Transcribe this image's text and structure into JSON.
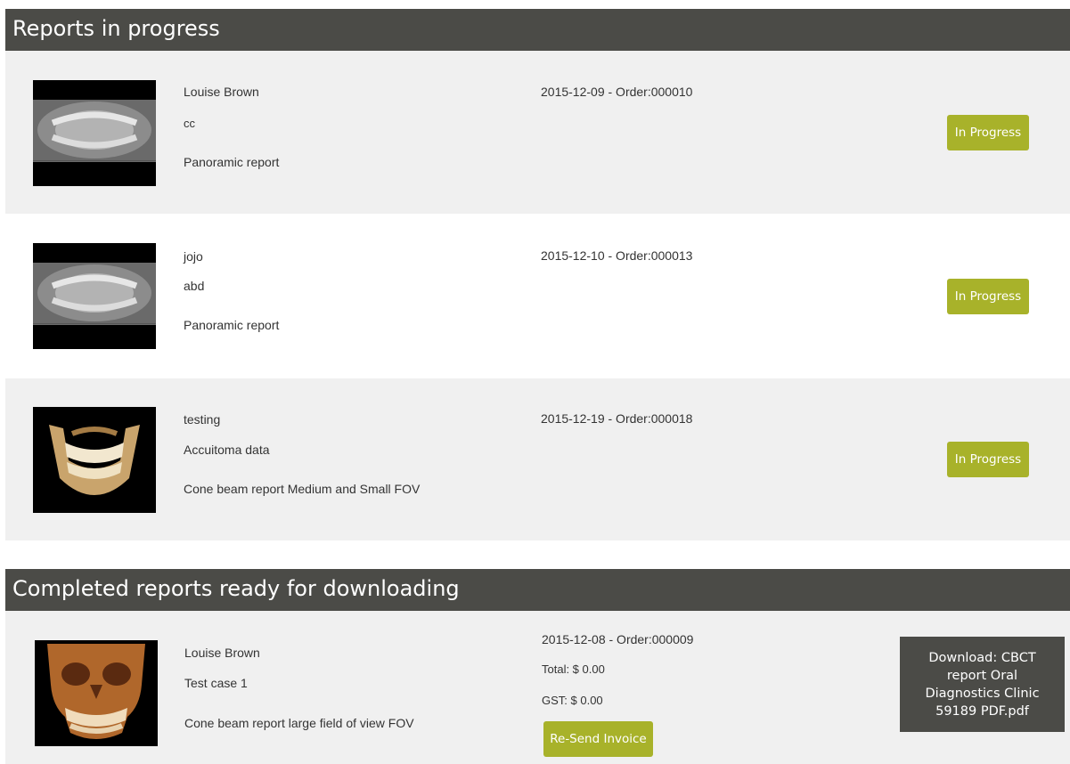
{
  "in_progress": {
    "title": "Reports in progress",
    "items": [
      {
        "patient": "Louise Brown",
        "note": "cc",
        "report_type": "Panoramic report",
        "order": "2015-12-09 - Order:000010",
        "status": "In Progress",
        "image": "panoramic-xray"
      },
      {
        "patient": "jojo",
        "note": "abd",
        "report_type": "Panoramic report",
        "order": "2015-12-10 - Order:000013",
        "status": "In Progress",
        "image": "panoramic-xray"
      },
      {
        "patient": "testing",
        "note": "Accuitoma data",
        "report_type": "Cone beam report Medium and Small FOV",
        "order": "2015-12-19 - Order:000018",
        "status": "In Progress",
        "image": "cbct-jaw-render"
      }
    ]
  },
  "completed": {
    "title": "Completed reports ready for downloading",
    "items": [
      {
        "patient": "Louise Brown",
        "note": "Test case 1",
        "report_type": "Cone beam report large field of view FOV",
        "order": "2015-12-08 - Order:000009",
        "total": "Total: $ 0.00",
        "gst": "GST: $ 0.00",
        "resend_label": "Re-Send Invoice",
        "download_label": "Download: CBCT report Oral Diagnostics Clinic 59189 PDF.pdf",
        "image": "cbct-skull-render"
      }
    ]
  },
  "colors": {
    "header_bg": "#4b4b47",
    "accent": "#a8b22a",
    "row_grey": "#f0f0f0"
  }
}
